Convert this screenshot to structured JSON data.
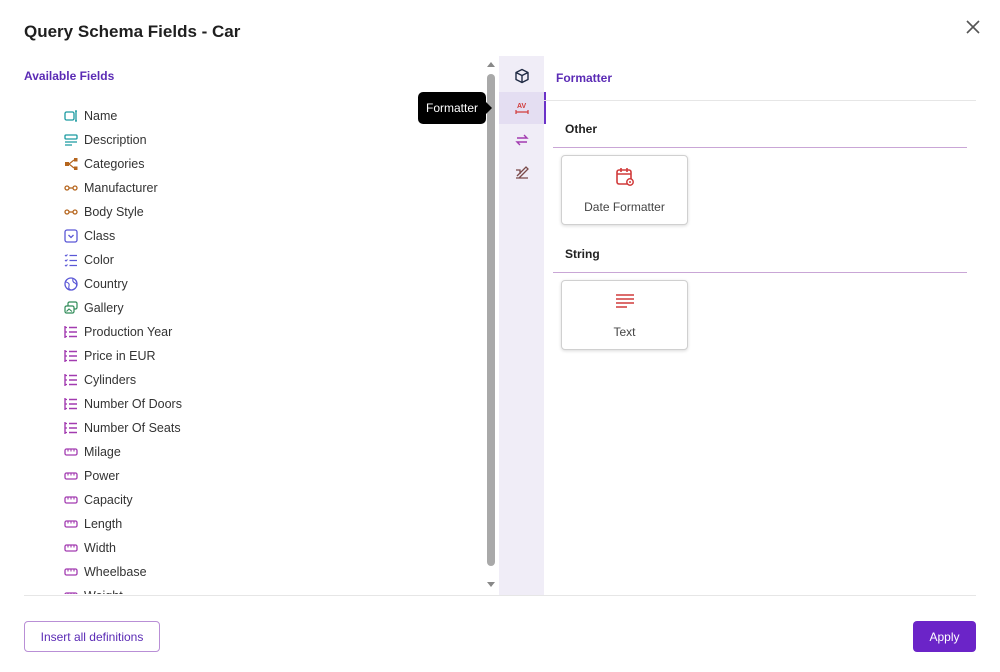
{
  "dialog": {
    "title": "Query Schema Fields - Car",
    "close_icon": "close-icon"
  },
  "available": {
    "title": "Available Fields",
    "fields": [
      {
        "label": "Name",
        "icon": "text-field-icon",
        "color": "#1a9aa0"
      },
      {
        "label": "Description",
        "icon": "rich-text-icon",
        "color": "#1a9aa0"
      },
      {
        "label": "Categories",
        "icon": "hierarchy-icon",
        "color": "#b5651d"
      },
      {
        "label": "Manufacturer",
        "icon": "relation-icon",
        "color": "#b5651d"
      },
      {
        "label": "Body Style",
        "icon": "relation-icon",
        "color": "#b5651d"
      },
      {
        "label": "Class",
        "icon": "dropdown-icon",
        "color": "#5a57d6"
      },
      {
        "label": "Color",
        "icon": "checklist-icon",
        "color": "#5a57d6"
      },
      {
        "label": "Country",
        "icon": "globe-icon",
        "color": "#5a57d6"
      },
      {
        "label": "Gallery",
        "icon": "gallery-icon",
        "color": "#2e8b57"
      },
      {
        "label": "Production Year",
        "icon": "numbered-list-icon",
        "color": "#a23bb0"
      },
      {
        "label": "Price in EUR",
        "icon": "numbered-list-icon",
        "color": "#a23bb0"
      },
      {
        "label": "Cylinders",
        "icon": "numbered-list-icon",
        "color": "#a23bb0"
      },
      {
        "label": "Number Of Doors",
        "icon": "numbered-list-icon",
        "color": "#a23bb0"
      },
      {
        "label": "Number Of Seats",
        "icon": "numbered-list-icon",
        "color": "#a23bb0"
      },
      {
        "label": "Milage",
        "icon": "measure-icon",
        "color": "#a23bb0"
      },
      {
        "label": "Power",
        "icon": "measure-icon",
        "color": "#a23bb0"
      },
      {
        "label": "Capacity",
        "icon": "measure-icon",
        "color": "#a23bb0"
      },
      {
        "label": "Length",
        "icon": "measure-icon",
        "color": "#a23bb0"
      },
      {
        "label": "Width",
        "icon": "measure-icon",
        "color": "#a23bb0"
      },
      {
        "label": "Wheelbase",
        "icon": "measure-icon",
        "color": "#a23bb0"
      },
      {
        "label": "Weight",
        "icon": "measure-icon",
        "color": "#a23bb0"
      }
    ]
  },
  "rail": {
    "buttons": [
      {
        "icon": "cube-icon",
        "active": false
      },
      {
        "icon": "formatter-icon",
        "active": true
      },
      {
        "icon": "transform-icon",
        "active": false
      },
      {
        "icon": "signature-icon",
        "active": false
      }
    ],
    "tooltip": "Formatter"
  },
  "panel": {
    "title": "Formatter",
    "sections": [
      {
        "heading": "Other",
        "cards": [
          {
            "label": "Date Formatter",
            "icon": "calendar-gear-icon"
          }
        ]
      },
      {
        "heading": "String",
        "cards": [
          {
            "label": "Text",
            "icon": "text-lines-icon"
          }
        ]
      }
    ]
  },
  "footer": {
    "insert_all_label": "Insert all definitions",
    "apply_label": "Apply"
  },
  "colors": {
    "accent": "#6b24c8",
    "heading": "#5b2bb5",
    "card_icon": "#d13b3b"
  }
}
